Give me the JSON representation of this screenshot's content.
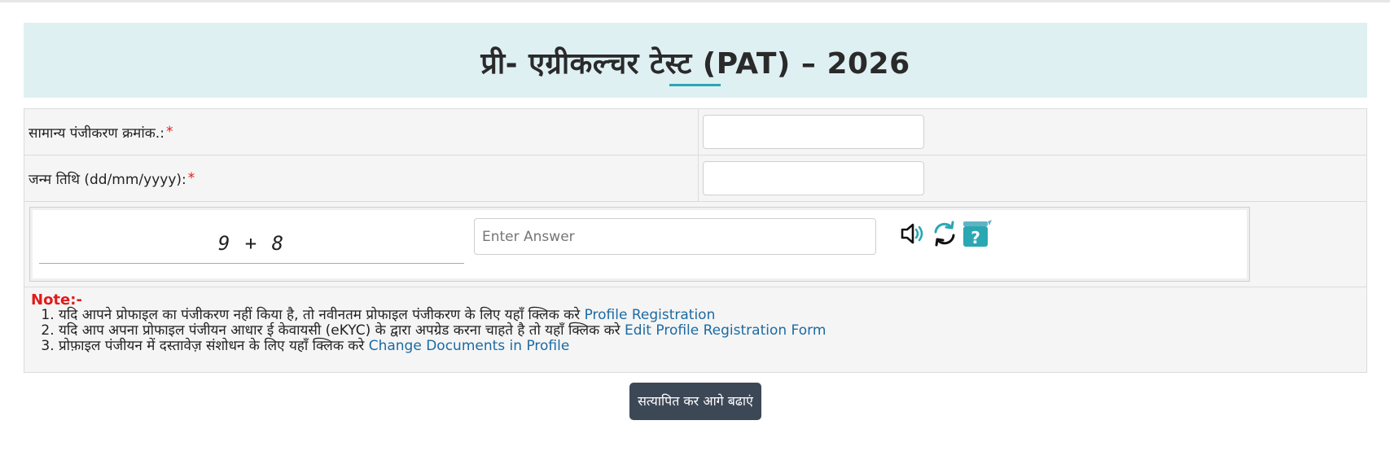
{
  "header": {
    "title": "प्री- एग्रीकल्चर टेस्ट (PAT) – 2026"
  },
  "form": {
    "registration": {
      "label": "सामान्य पंजीकरण क्रमांक.:",
      "required_mark": "*",
      "value": ""
    },
    "dob": {
      "label": "जन्म तिथि (dd/mm/yyyy):",
      "required_mark": "*",
      "value": ""
    }
  },
  "captcha": {
    "question": "9 + 8",
    "answer_placeholder": "Enter Answer",
    "answer_value": "",
    "icons": [
      "speaker-icon",
      "refresh-icon",
      "help-icon"
    ]
  },
  "note": {
    "title": "Note:-",
    "items": [
      {
        "text": "यदि आपने प्रोफाइल का पंजीकरण नहीं किया है, तो नवीनतम प्रोफाइल पंजीकरण के लिए यहाँ क्लिक करे",
        "link": "Profile Registration"
      },
      {
        "text": "यदि आप अपना प्रोफाइल पंजीयन आधार ई केवायसी (eKYC) के द्वारा अपग्रेड करना चाहते है तो यहाँ क्लिक करे",
        "link": "Edit Profile Registration Form"
      },
      {
        "text": "प्रोफ़ाइल पंजीयन में दस्तावेज़ संशोधन के लिए यहाँ क्लिक करे",
        "link": "Change Documents in Profile"
      }
    ]
  },
  "submit": {
    "label": "सत्यापित कर आगे बढाएं"
  },
  "colors": {
    "header_bg": "#dff0f3",
    "accent": "#2aa7b3",
    "required": "#e21a1a",
    "link": "#1b6aa3",
    "button_bg": "#3d4857"
  }
}
